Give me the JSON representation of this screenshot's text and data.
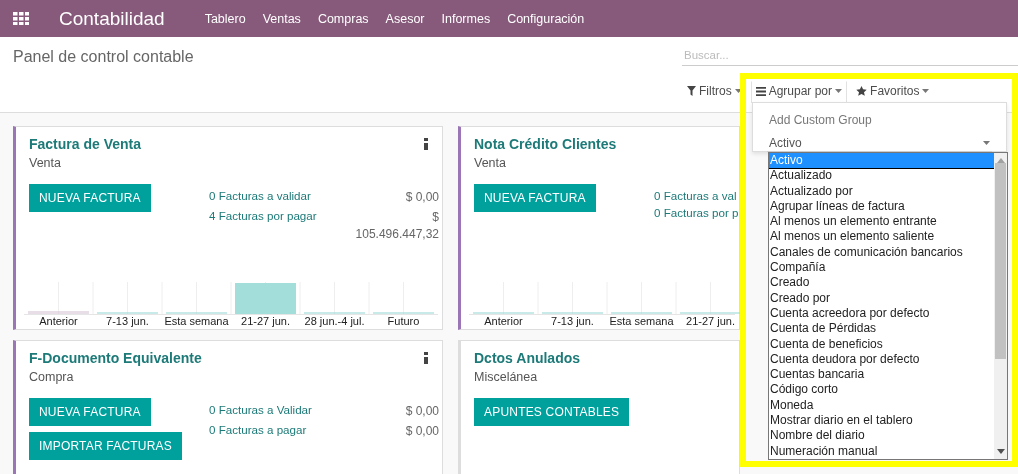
{
  "app": {
    "title": "Contabilidad"
  },
  "menu": [
    "Tablero",
    "Ventas",
    "Compras",
    "Asesor",
    "Informes",
    "Configuración"
  ],
  "page_title": "Panel de control contable",
  "search": {
    "placeholder": "Buscar..."
  },
  "search_buttons": [
    {
      "label": "Filtros",
      "kind": "filter",
      "open": false
    },
    {
      "label": "Agrupar por",
      "kind": "group",
      "open": true
    },
    {
      "label": "Favoritos",
      "kind": "favorite",
      "open": false
    }
  ],
  "group_menu": {
    "heading": "Add Custom Group",
    "select_value": "Activo",
    "options": [
      {
        "label": "Activo",
        "selected": true
      },
      {
        "label": "Actualizado",
        "selected": false
      },
      {
        "label": "Actualizado por",
        "selected": false
      },
      {
        "label": "Agrupar líneas de factura",
        "selected": false
      },
      {
        "label": "Al menos un elemento entrante",
        "selected": false
      },
      {
        "label": "Al menos un elemento saliente",
        "selected": false
      },
      {
        "label": "Canales de comunicación bancarios",
        "selected": false
      },
      {
        "label": "Compañía",
        "selected": false
      },
      {
        "label": "Creado",
        "selected": false
      },
      {
        "label": "Creado por",
        "selected": false
      },
      {
        "label": "Cuenta acreedora por defecto",
        "selected": false
      },
      {
        "label": "Cuenta de Pérdidas",
        "selected": false
      },
      {
        "label": "Cuenta de beneficios",
        "selected": false
      },
      {
        "label": "Cuenta deudora por defecto",
        "selected": false
      },
      {
        "label": "Cuentas bancaria",
        "selected": false
      },
      {
        "label": "Código corto",
        "selected": false
      },
      {
        "label": "Moneda",
        "selected": false
      },
      {
        "label": "Mostrar diario en el tablero",
        "selected": false
      },
      {
        "label": "Nombre del diario",
        "selected": false
      },
      {
        "label": "Numeración manual",
        "selected": false
      }
    ]
  },
  "cards": [
    {
      "title": "Factura de Venta",
      "subtitle": "Venta",
      "accent": true,
      "menu_icon": true,
      "buttons": [
        "NUEVA FACTURA"
      ],
      "stats": [
        {
          "label": "0 Facturas a validar",
          "amount": "$ 0,00"
        },
        {
          "label": "4 Facturas por pagar",
          "amount": "$ 105.496.447,32"
        }
      ],
      "graph": {
        "kind": "activity",
        "labels": [
          "Anterior",
          "7-13 jun.",
          "Esta semana",
          "21-27 jun.",
          "28 jun.-4 jul.",
          "Futuro"
        ]
      }
    },
    {
      "title": "Nota Crédito Clientes",
      "subtitle": "Venta",
      "accent": true,
      "menu_icon": false,
      "buttons": [
        "NUEVA FACTURA"
      ],
      "stats": [
        {
          "label": "0 Facturas a val"
        },
        {
          "label": "0 Facturas por p"
        }
      ],
      "graph": {
        "kind": "flat",
        "labels": [
          "Anterior",
          "7-13 jun.",
          "Esta semana",
          "21-27 jun."
        ]
      }
    },
    {
      "title": "F-Documento Equivalente",
      "subtitle": "Compra",
      "accent": true,
      "menu_icon": true,
      "buttons": [
        "NUEVA FACTURA",
        "IMPORTAR FACTURAS"
      ],
      "stats": [
        {
          "label": "0 Facturas a Validar",
          "amount": "$ 0,00"
        },
        {
          "label": "0 Facturas a pagar",
          "amount": "$ 0,00"
        }
      ]
    },
    {
      "title": "Dctos Anulados",
      "subtitle": "Miscelánea",
      "accent": false,
      "menu_icon": false,
      "buttons": [
        "APUNTES CONTABLES"
      ]
    }
  ]
}
